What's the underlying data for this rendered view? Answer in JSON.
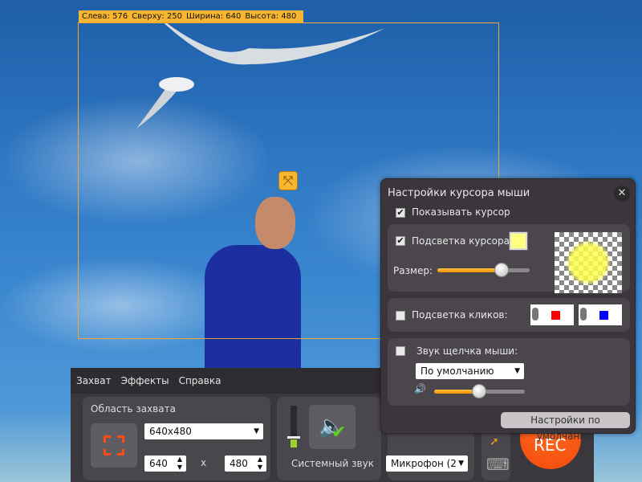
{
  "overlay": {
    "left_label": "Слева: 576",
    "top_label": "Сверху: 250",
    "width_label": "Ширина: 640",
    "height_label": "Высота: 480"
  },
  "menu": [
    "Захват",
    "Эффекты",
    "Справка"
  ],
  "capture_area": {
    "title": "Область захвата",
    "preset": "640x480",
    "width": "640",
    "times": "x",
    "height": "480"
  },
  "system_sound": {
    "label": "Системный звук",
    "volume": 0.25,
    "enabled": true
  },
  "microphone": {
    "selected": "Микрофон (2"
  },
  "rec_label": "REC",
  "cursor_settings": {
    "title": "Настройки курсора мыши",
    "show_cursor": {
      "label": "Показывать курсор",
      "checked": true
    },
    "highlight": {
      "label": "Подсветка курсора:",
      "checked": true,
      "color": "#ffff80",
      "size_label": "Размер:",
      "size": 0.7
    },
    "click_highlight": {
      "label": "Подсветка кликов:",
      "checked": false,
      "left_color": "#ff0000",
      "right_color": "#0000ff"
    },
    "click_sound": {
      "label": "Звук щелчка мыши:",
      "checked": false,
      "sound": "По умолчанию",
      "volume": 0.5
    },
    "defaults_button": "Настройки по умолчанию"
  },
  "colors": {
    "accent": "#f7b530",
    "rec": "#f24a0a"
  }
}
